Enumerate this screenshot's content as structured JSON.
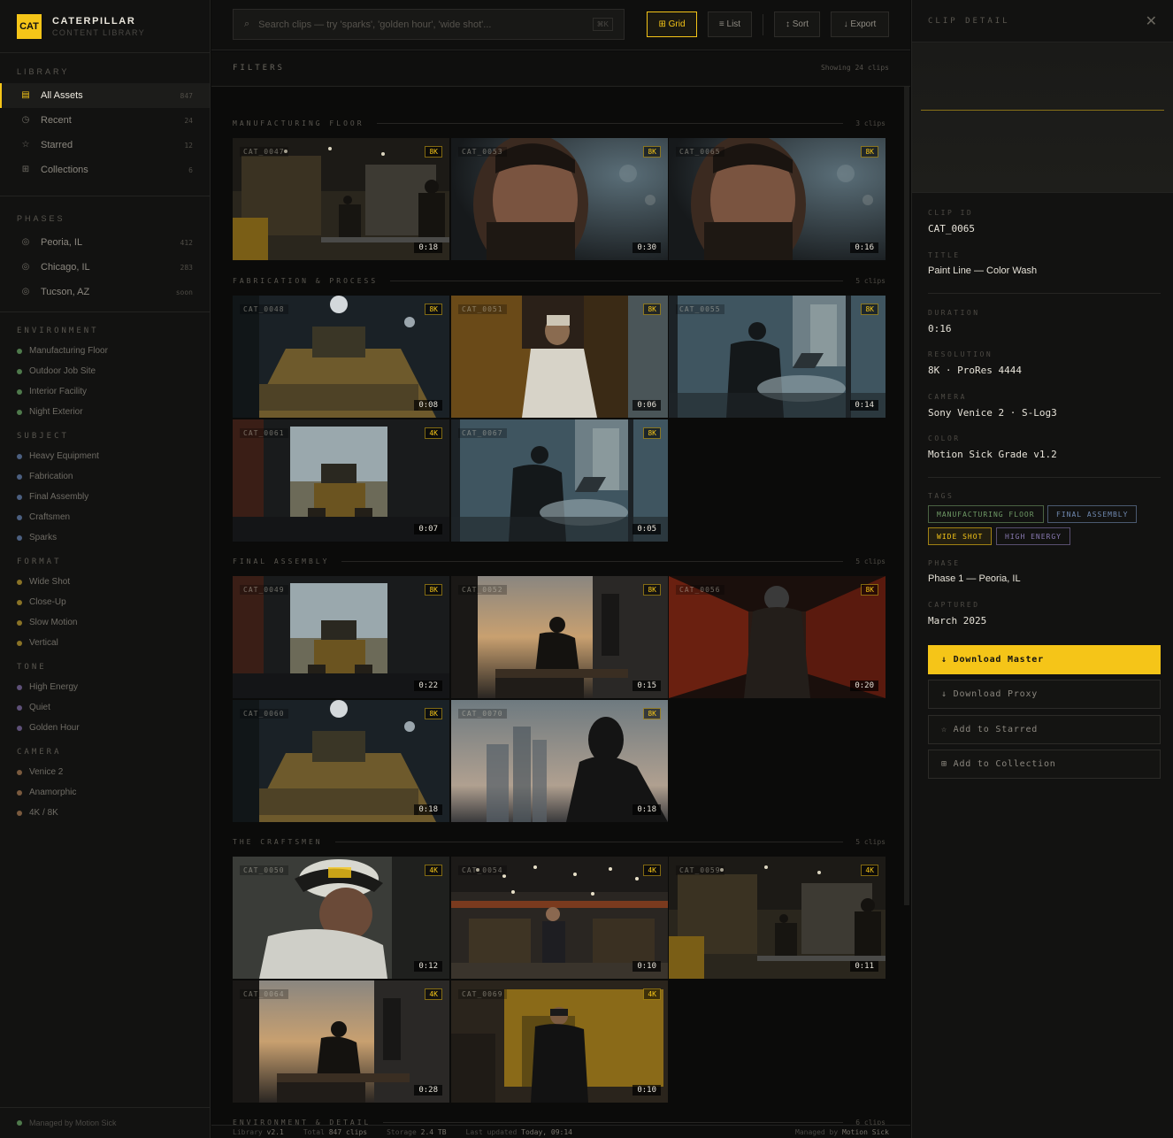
{
  "brand": {
    "logo": "CAT",
    "name": "CATERPILLAR",
    "subtitle": "CONTENT LIBRARY"
  },
  "sidebar": {
    "library_title": "LIBRARY",
    "library": [
      {
        "label": "All Assets",
        "count": "847",
        "icon": "grid-icon",
        "glyph": "▤",
        "active": true
      },
      {
        "label": "Recent",
        "count": "24",
        "icon": "clock-icon",
        "glyph": "◷"
      },
      {
        "label": "Starred",
        "count": "12",
        "icon": "star-icon",
        "glyph": "☆"
      },
      {
        "label": "Collections",
        "count": "6",
        "icon": "collection-icon",
        "glyph": "⊞"
      }
    ],
    "phases_title": "PHASES",
    "phases": [
      {
        "label": "Peoria, IL",
        "count": "412",
        "icon": "location-icon",
        "glyph": "◎"
      },
      {
        "label": "Chicago, IL",
        "count": "283",
        "icon": "location-icon",
        "glyph": "◎"
      },
      {
        "label": "Tucson, AZ",
        "count": "soon",
        "icon": "location-icon",
        "glyph": "◎"
      }
    ],
    "tag_groups": [
      {
        "title": "ENVIRONMENT",
        "color": "#4f7a4c",
        "items": [
          "Manufacturing Floor",
          "Outdoor Job Site",
          "Interior Facility",
          "Night Exterior"
        ]
      },
      {
        "title": "SUBJECT",
        "color": "#4b5f80",
        "items": [
          "Heavy Equipment",
          "Fabrication",
          "Final Assembly",
          "Craftsmen",
          "Sparks"
        ]
      },
      {
        "title": "FORMAT",
        "color": "#8a7326",
        "items": [
          "Wide Shot",
          "Close-Up",
          "Slow Motion",
          "Vertical"
        ]
      },
      {
        "title": "TONE",
        "color": "#5e5078",
        "items": [
          "High Energy",
          "Quiet",
          "Golden Hour"
        ]
      },
      {
        "title": "CAMERA",
        "color": "#7a5a3e",
        "items": [
          "Venice 2",
          "Anamorphic",
          "4K / 8K"
        ]
      }
    ],
    "footer": "Managed by Motion Sick"
  },
  "topbar": {
    "search_placeholder": "Search clips — try 'sparks', 'golden hour', 'wide shot'...",
    "search_shortcut": "⌘K",
    "grid_label": "⊞ Grid",
    "list_label": "≡ List",
    "sort_label": "↕ Sort",
    "export_label": "↓ Export"
  },
  "filters": {
    "label": "FILTERS",
    "showing": "Showing 24 clips"
  },
  "groups": [
    {
      "title": "MANUFACTURING FLOOR",
      "count": "3 clips",
      "clips": [
        {
          "id": "CAT_0047",
          "res": "8K",
          "dur": "0:18",
          "scene": "factory"
        },
        {
          "id": "CAT_0053",
          "res": "8K",
          "dur": "0:30",
          "scene": "portrait"
        },
        {
          "id": "CAT_0065",
          "res": "8K",
          "dur": "0:16",
          "scene": "portrait"
        }
      ]
    },
    {
      "title": "FABRICATION & PROCESS",
      "count": "5 clips",
      "clips": [
        {
          "id": "CAT_0048",
          "res": "8K",
          "dur": "0:08",
          "scene": "dozer-blue"
        },
        {
          "id": "CAT_0051",
          "res": "8K",
          "dur": "0:06",
          "scene": "warm-hall"
        },
        {
          "id": "CAT_0055",
          "res": "8K",
          "dur": "0:14",
          "scene": "window-laptop"
        },
        {
          "id": "CAT_0061",
          "res": "4K",
          "dur": "0:07",
          "scene": "doorway"
        },
        {
          "id": "CAT_0067",
          "res": "8K",
          "dur": "0:05",
          "scene": "window-laptop"
        }
      ]
    },
    {
      "title": "FINAL ASSEMBLY",
      "count": "5 clips",
      "clips": [
        {
          "id": "CAT_0049",
          "res": "8K",
          "dur": "0:22",
          "scene": "doorway"
        },
        {
          "id": "CAT_0052",
          "res": "8K",
          "dur": "0:15",
          "scene": "office-sunset"
        },
        {
          "id": "CAT_0056",
          "res": "8K",
          "dur": "0:20",
          "scene": "red-corridor"
        },
        {
          "id": "CAT_0060",
          "res": "8K",
          "dur": "0:18",
          "scene": "dozer-blue"
        },
        {
          "id": "CAT_0070",
          "res": "8K",
          "dur": "0:18",
          "scene": "city-silhouette"
        }
      ]
    },
    {
      "title": "THE CRAFTSMEN",
      "count": "5 clips",
      "clips": [
        {
          "id": "CAT_0050",
          "res": "4K",
          "dur": "0:12",
          "scene": "cap-man"
        },
        {
          "id": "CAT_0054",
          "res": "4K",
          "dur": "0:10",
          "scene": "big-factory"
        },
        {
          "id": "CAT_0059",
          "res": "4K",
          "dur": "0:11",
          "scene": "factory"
        },
        {
          "id": "CAT_0064",
          "res": "4K",
          "dur": "0:28",
          "scene": "office-sunset"
        },
        {
          "id": "CAT_0069",
          "res": "4K",
          "dur": "0:10",
          "scene": "yellow-machine"
        }
      ]
    },
    {
      "title": "ENVIRONMENT & DETAIL",
      "count": "6 clips",
      "clips": []
    }
  ],
  "statusbar": {
    "library_label": "Library",
    "library_value": "v2.1",
    "total_label": "Total",
    "total_value": "847 clips",
    "storage_label": "Storage",
    "storage_value": "2.4 TB",
    "updated_label": "Last updated",
    "updated_value": "Today, 09:14",
    "managed_label": "Managed by",
    "managed_value": "Motion Sick"
  },
  "detail": {
    "header": "CLIP DETAIL",
    "clip_id_label": "CLIP ID",
    "clip_id": "CAT_0065",
    "title_label": "TITLE",
    "title": "Paint Line — Color Wash",
    "duration_label": "DURATION",
    "duration": "0:16",
    "resolution_label": "RESOLUTION",
    "resolution": "8K · ProRes 4444",
    "camera_label": "CAMERA",
    "camera": "Sony Venice 2 · S-Log3",
    "color_label": "COLOR",
    "color": "Motion Sick Grade v1.2",
    "tags_label": "TAGS",
    "tags": [
      {
        "label": "MANUFACTURING FLOOR",
        "color": "#6f9a66"
      },
      {
        "label": "FINAL ASSEMBLY",
        "color": "#7089b0"
      },
      {
        "label": "WIDE SHOT",
        "color": "#f5c518"
      },
      {
        "label": "HIGH ENERGY",
        "color": "#8878b0"
      }
    ],
    "phase_label": "PHASE",
    "phase": "Phase 1 — Peoria, IL",
    "captured_label": "CAPTURED",
    "captured": "March 2025",
    "actions": {
      "download_master": "↓ Download Master",
      "download_proxy": "↓ Download Proxy",
      "add_starred": "☆ Add to Starred",
      "add_collection": "⊞ Add to Collection"
    }
  }
}
